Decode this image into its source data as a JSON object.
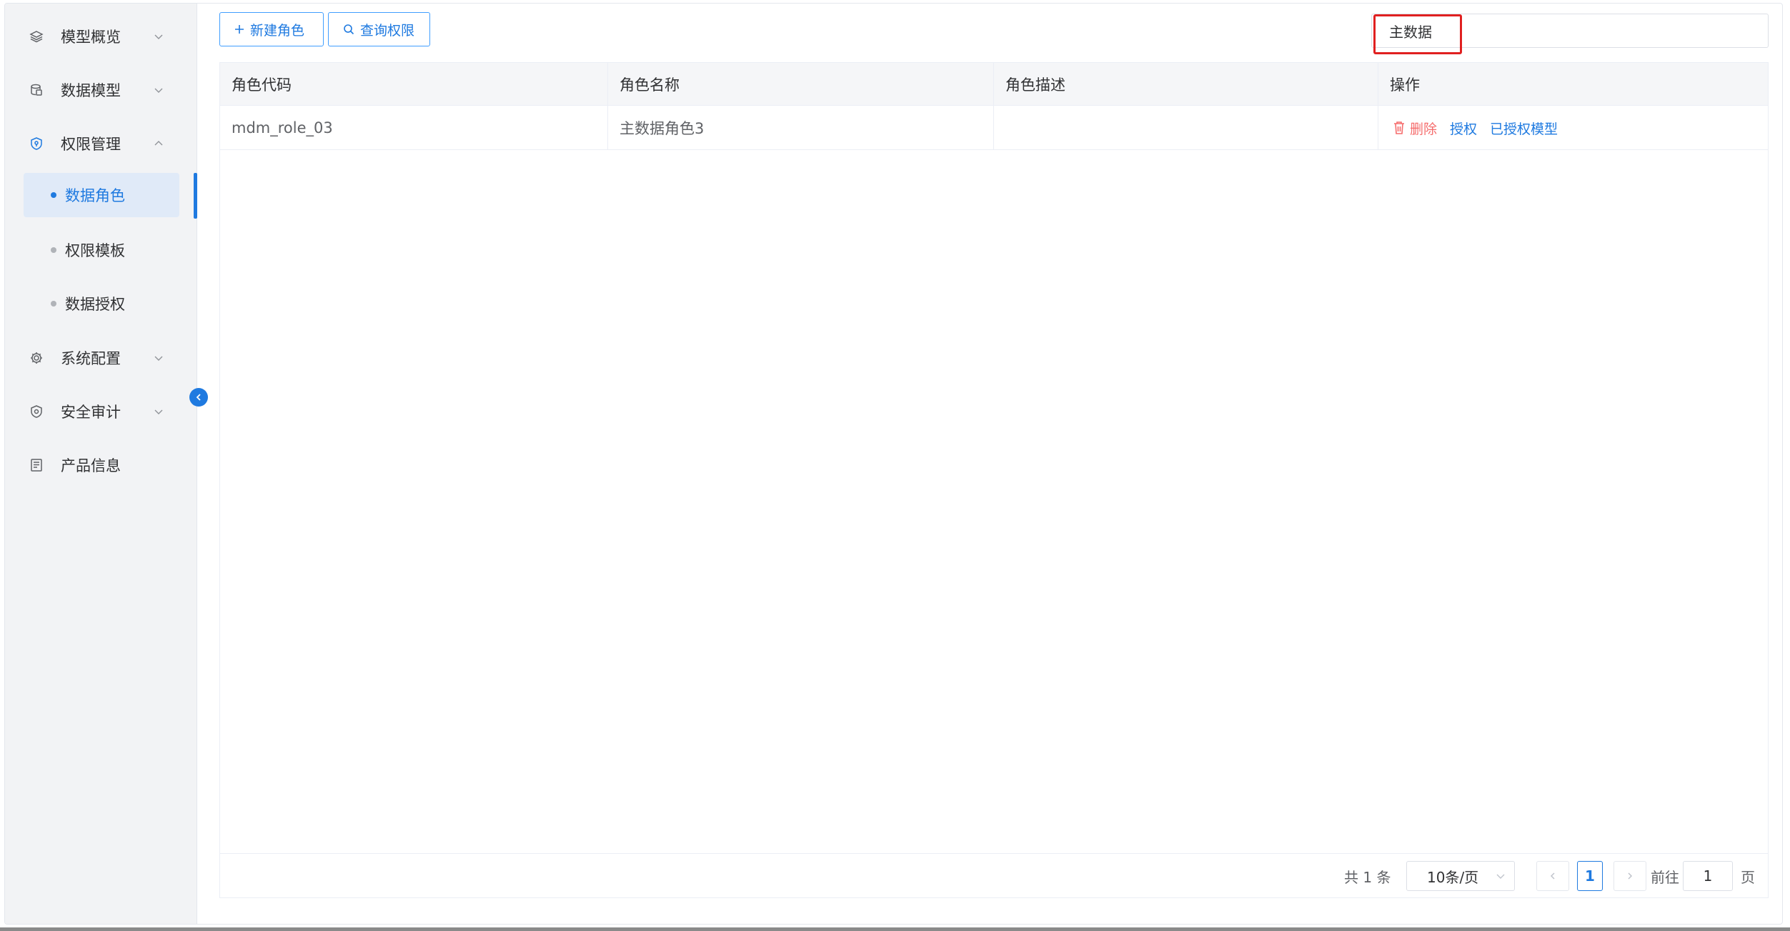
{
  "sidebar": {
    "menu": [
      {
        "label": "模型概览",
        "icon": "layers-icon",
        "arrow": "down"
      },
      {
        "label": "数据模型",
        "icon": "database-icon",
        "arrow": "down"
      },
      {
        "label": "权限管理",
        "icon": "shield-icon",
        "arrow": "up"
      },
      {
        "label": "系统配置",
        "icon": "gear-icon",
        "arrow": "down"
      },
      {
        "label": "安全审计",
        "icon": "audit-shield-icon",
        "arrow": "down"
      },
      {
        "label": "产品信息",
        "icon": "document-icon",
        "arrow": ""
      }
    ],
    "submenu": [
      {
        "label": "数据角色",
        "active": true
      },
      {
        "label": "权限模板",
        "active": false
      },
      {
        "label": "数据授权",
        "active": false
      }
    ],
    "accent_color": "#1f7ae0"
  },
  "toolbar": {
    "new_role_label": "新建角色",
    "query_permission_label": "查询权限",
    "search_value": "主数据"
  },
  "table": {
    "columns": [
      "角色代码",
      "角色名称",
      "角色描述",
      "操作"
    ],
    "rows": [
      {
        "code": "mdm_role_03",
        "name": "主数据角色3",
        "description": ""
      }
    ],
    "actions": {
      "delete": "删除",
      "authorize": "授权",
      "authorized_models": "已授权模型"
    }
  },
  "pagination": {
    "total": "共 1 条",
    "page_size": "10条/页",
    "current_page": "1",
    "goto_prefix": "前往",
    "goto_value": "1",
    "goto_suffix": "页"
  }
}
